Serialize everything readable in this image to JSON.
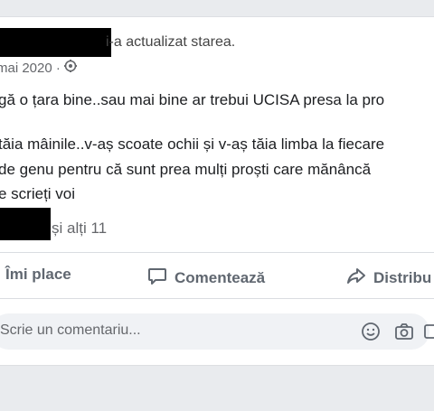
{
  "post": {
    "header_suffix": "i-a actualizat starea.",
    "date": "mai 2020 ·",
    "lines": [
      "gă o țara bine..sau mai bine ar trebui UCISA presa la pro",
      "tăia mâinile..v-aș scoate ochii și v-aș tăia limba la fiecare",
      "de genu pentru că sunt prea mulți proști care mănâncă",
      "e scrieți voi"
    ],
    "reactions_suffix": "și alți 11"
  },
  "actions": {
    "like": "Îmi place",
    "comment": "Comentează",
    "share": "Distribu"
  },
  "comment_box": {
    "placeholder": "Scrie un comentariu..."
  },
  "icons": {
    "privacy": "settings-icon",
    "comment": "speech-bubble-icon",
    "share": "share-arrow-icon",
    "emoji": "smiley-icon",
    "camera": "camera-icon",
    "gif": "gif-icon"
  }
}
